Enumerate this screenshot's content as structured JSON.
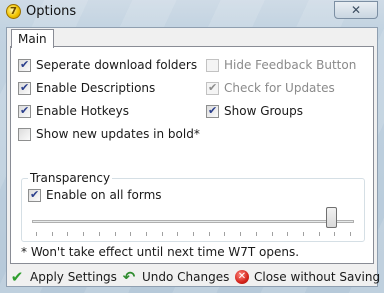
{
  "window": {
    "title": "Options",
    "close_glyph": "✕",
    "app_icon_glyph": "7"
  },
  "tabs": [
    {
      "label": "Main",
      "selected": true
    }
  ],
  "checkboxes": [
    {
      "label": "Seperate download folders",
      "checked": true,
      "enabled": true
    },
    {
      "label": "Enable Descriptions",
      "checked": true,
      "enabled": true
    },
    {
      "label": "Enable Hotkeys",
      "checked": true,
      "enabled": true
    },
    {
      "label": "Show new updates in bold*",
      "checked": false,
      "enabled": true
    },
    {
      "label": "Hide Feedback Button",
      "checked": false,
      "enabled": false
    },
    {
      "label": "Check for Updates",
      "checked": true,
      "enabled": false
    },
    {
      "label": "Show Groups",
      "checked": true,
      "enabled": true
    }
  ],
  "transparency": {
    "title": "Transparency",
    "enable_label": "Enable on all forms",
    "enable_checked": true,
    "slider_value_fraction": 0.94,
    "tick_count": 21
  },
  "note": "* Won't take effect until next time W7T opens.",
  "footer": {
    "apply": "Apply Settings",
    "undo": "Undo Changes",
    "close": "Close without Saving"
  },
  "icons": {
    "apply": "check-icon",
    "undo": "undo-icon",
    "close": "close-circle-icon"
  },
  "colors": {
    "checkmark": "#2a3e8c",
    "apply_icon": "#2e9e2e",
    "close_icon": "#d3231b"
  }
}
